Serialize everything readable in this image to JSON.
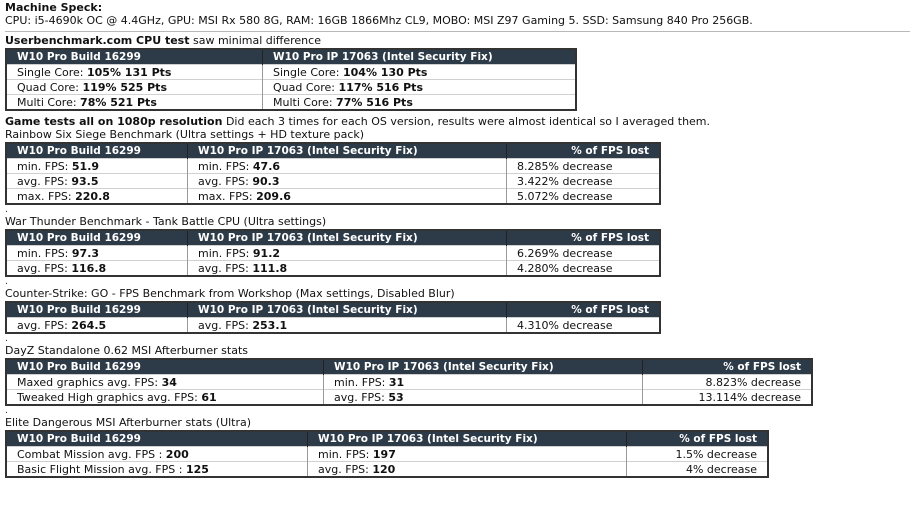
{
  "machine": {
    "heading": "Machine Speck:",
    "specs": "CPU: i5-4690k OC @ 4.4GHz, GPU: MSI Rx 580 8G, RAM: 16GB 1866Mhz CL9, MOBO: MSI Z97 Gaming 5. SSD: Samsung 840 Pro 256GB."
  },
  "userbench": {
    "heading_bold": "Userbenchmark.com CPU test",
    "heading_rest": " saw minimal difference",
    "headers": [
      "W10 Pro Build 16299",
      "W10 Pro IP 17063 (Intel Security Fix)"
    ],
    "rows": [
      [
        {
          "label": "Single Core: ",
          "value": "105% 131 Pts"
        },
        {
          "label": "Single Core: ",
          "value": "104% 130 Pts"
        }
      ],
      [
        {
          "label": "Quad Core: ",
          "value": "119% 525 Pts"
        },
        {
          "label": "Quad Core: ",
          "value": "117% 516 Pts"
        }
      ],
      [
        {
          "label": "Multi Core: ",
          "value": "78% 521 Pts"
        },
        {
          "label": "Multi Core: ",
          "value": "77% 516 Pts"
        }
      ]
    ]
  },
  "game_intro": {
    "bold": "Game tests all on 1080p resolution",
    "rest": " Did each 3 times for each OS version, results were almost identical so I averaged them."
  },
  "dot": ".",
  "games": [
    {
      "title": "Rainbow Six Siege Benchmark (Ultra settings + HD texture pack)",
      "headers": [
        "W10 Pro Build 16299",
        "W10 Pro IP 17063 (Intel Security Fix)",
        "% of FPS lost"
      ],
      "rows": [
        [
          {
            "label": "min. FPS: ",
            "value": "51.9"
          },
          {
            "label": "min. FPS: ",
            "value": "47.6"
          },
          "8.285% decrease"
        ],
        [
          {
            "label": "avg. FPS: ",
            "value": "93.5"
          },
          {
            "label": "avg. FPS: ",
            "value": "90.3"
          },
          "3.422% decrease"
        ],
        [
          {
            "label": "max. FPS: ",
            "value": "220.8"
          },
          {
            "label": "max. FPS: ",
            "value": "209.6"
          },
          "5.072% decrease"
        ]
      ]
    },
    {
      "title": "War Thunder Benchmark - Tank Battle CPU (Ultra settings)",
      "headers": [
        "W10 Pro Build 16299",
        "W10 Pro IP 17063 (Intel Security Fix)",
        "% of FPS lost"
      ],
      "rows": [
        [
          {
            "label": "min. FPS: ",
            "value": "97.3"
          },
          {
            "label": "min. FPS: ",
            "value": "91.2"
          },
          "6.269% decrease"
        ],
        [
          {
            "label": "avg. FPS: ",
            "value": "116.8"
          },
          {
            "label": "avg. FPS: ",
            "value": "111.8"
          },
          "4.280% decrease"
        ]
      ]
    },
    {
      "title": "Counter-Strike: GO - FPS Benchmark from Workshop (Max settings, Disabled Blur)",
      "headers": [
        "W10 Pro Build 16299",
        "W10 Pro IP 17063 (Intel Security Fix)",
        "% of FPS lost"
      ],
      "rows": [
        [
          {
            "label": "avg. FPS: ",
            "value": "264.5"
          },
          {
            "label": "avg. FPS: ",
            "value": "253.1"
          },
          "4.310% decrease"
        ]
      ]
    },
    {
      "title": "DayZ Standalone 0.62 MSI Afterburner stats",
      "headers": [
        "W10 Pro Build 16299",
        "W10 Pro IP 17063 (Intel Security Fix)",
        "% of FPS lost"
      ],
      "rows": [
        [
          {
            "label": "Maxed graphics avg. FPS: ",
            "value": "34"
          },
          {
            "label": "min. FPS: ",
            "value": "31"
          },
          "8.823% decrease"
        ],
        [
          {
            "label": "Tweaked High graphics avg. FPS: ",
            "value": "61"
          },
          {
            "label": "avg. FPS: ",
            "value": "53"
          },
          "13.114% decrease"
        ]
      ]
    },
    {
      "title": "Elite Dangerous MSI Afterburner stats (Ultra)",
      "headers": [
        "W10 Pro Build 16299",
        "W10 Pro IP 17063 (Intel Security Fix)",
        "% of FPS lost"
      ],
      "rows": [
        [
          {
            "label": "Combat Mission avg. FPS : ",
            "value": "200"
          },
          {
            "label": "min. FPS: ",
            "value": "197"
          },
          "1.5% decrease"
        ],
        [
          {
            "label": "Basic Flight Mission avg. FPS : ",
            "value": "125"
          },
          {
            "label": "avg. FPS: ",
            "value": "120"
          },
          "4% decrease"
        ]
      ]
    }
  ],
  "style": {
    "header_bg": "#2d3a47",
    "header_text": "#ffffff",
    "border": "#333333"
  }
}
